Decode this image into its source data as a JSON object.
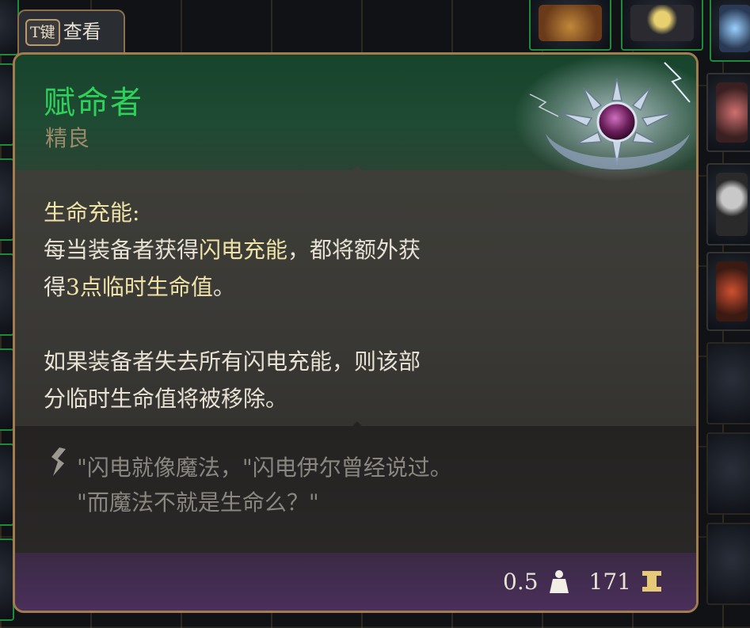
{
  "keyhint": {
    "key": "T键",
    "label": "查看"
  },
  "item": {
    "name": "赋命者",
    "rarity": "精良",
    "name_color": "#2ed15a",
    "rarity_color": "#9a8a6a"
  },
  "description": {
    "heading": "生命充能:",
    "line1_pre": "每当装备者获得",
    "line1_hl": "闪电充能",
    "line1_post": "，都将额外获",
    "line2_pre": "得",
    "line2_hl": "3点临时生命值",
    "line2_post": "。",
    "para2_line1": "如果装备者失去所有闪电充能，则该部",
    "para2_line2": "分临时生命值将被移除。"
  },
  "flavor": {
    "line1": "\"闪电就像魔法，\"闪电伊尔曾经说过。",
    "line2": "\"而魔法不就是生命么？\""
  },
  "stats": {
    "weight": "0.5",
    "weight_icon": "weight-icon",
    "value": "171",
    "value_icon": "gold-icon"
  }
}
